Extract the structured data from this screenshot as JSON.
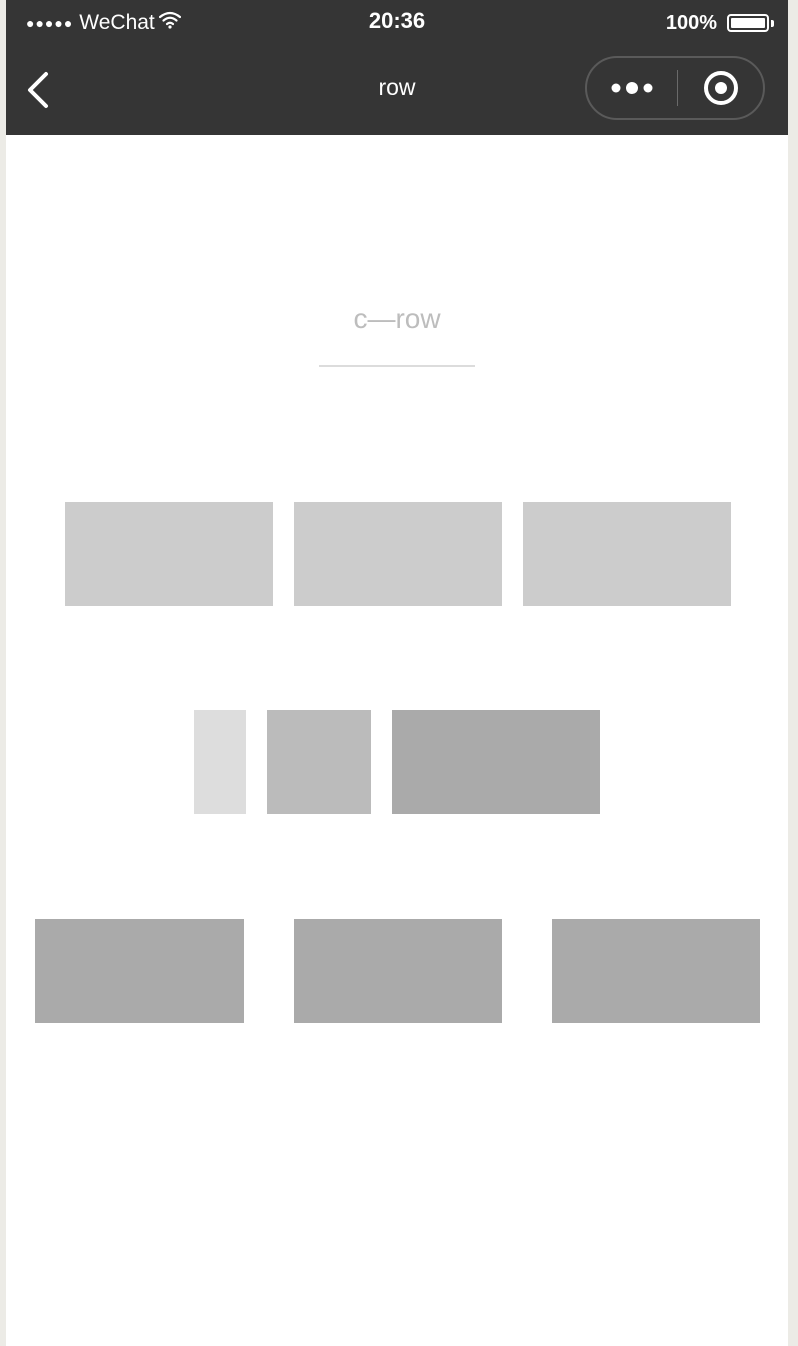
{
  "status_bar": {
    "signal_dots": "●●●●●",
    "carrier": "WeChat",
    "wifi_icon": "wifi-icon",
    "time": "20:36",
    "battery_percent": "100%",
    "battery_level": 1.0
  },
  "nav_bar": {
    "back_icon": "chevron-left-icon",
    "title": "row",
    "more_icon": "more-dots-icon",
    "close_icon": "target-circle-icon"
  },
  "page": {
    "heading": "c—row"
  },
  "colors": {
    "bar_background": "#353535",
    "block_light": "#cccccc",
    "block_lighter": "#dddddd",
    "block_mid": "#bbbbbb",
    "block_dark": "#aaaaaa",
    "heading_text": "#bdbdbd"
  }
}
